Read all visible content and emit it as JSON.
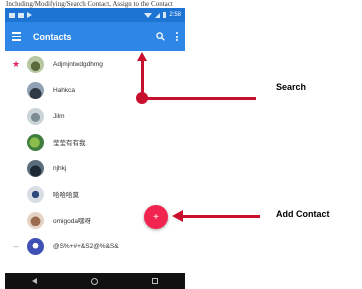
{
  "caption": "Including/Modifying/Search Contact, Assign to the Contact",
  "status_bar": {
    "time": "2:58"
  },
  "app_bar": {
    "title": "Contacts"
  },
  "contacts": [
    {
      "name": "Adjmjntwdgdhmg",
      "favorite": true,
      "favorite_icon": "star-icon"
    },
    {
      "name": "Hahkca"
    },
    {
      "name": "Jilm"
    },
    {
      "name": "莹莹有有我"
    },
    {
      "name": "njhkj"
    },
    {
      "name": "哈哈哈莫"
    },
    {
      "name": "omigoda嘿呀"
    },
    {
      "name": "@S%+#+&S2@%&S&"
    }
  ],
  "fab": {
    "label": "+"
  },
  "annotations": {
    "search_label": "Search",
    "add_contact_label": "Add Contact",
    "color": "#c8102e"
  },
  "colors": {
    "status_bar": "#1e74d3",
    "app_bar": "#2e86e7",
    "fab": "#f0244e",
    "nav_bar": "#111111"
  }
}
